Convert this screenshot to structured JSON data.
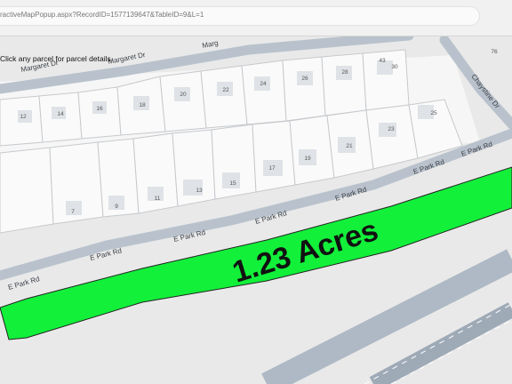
{
  "browser": {
    "url": "ractiveMapPopup.aspx?RecordID=1577139647&TableID=9&L=1"
  },
  "map": {
    "hint": "Click any parcel for parcel details.",
    "acres_label": "1.23 Acres",
    "parcel_color": "#12f03a",
    "streets": {
      "margaret_1": "Margaret Dr",
      "margaret_2": "Margaret Dr",
      "margaret_3": "Marg",
      "chaystine": "Chaystine Dr",
      "e_park": [
        "E Park Rd",
        "E Park Rd",
        "E Park Rd",
        "E Park Rd",
        "E Park Rd",
        "E Park Rd",
        "E Park Rd"
      ]
    },
    "lots": [
      "12",
      "14",
      "16",
      "18",
      "20",
      "22",
      "24",
      "26",
      "28",
      "43",
      "30",
      "25",
      "23",
      "21",
      "19",
      "17",
      "15",
      "13",
      "11",
      "9",
      "7",
      "76"
    ]
  }
}
